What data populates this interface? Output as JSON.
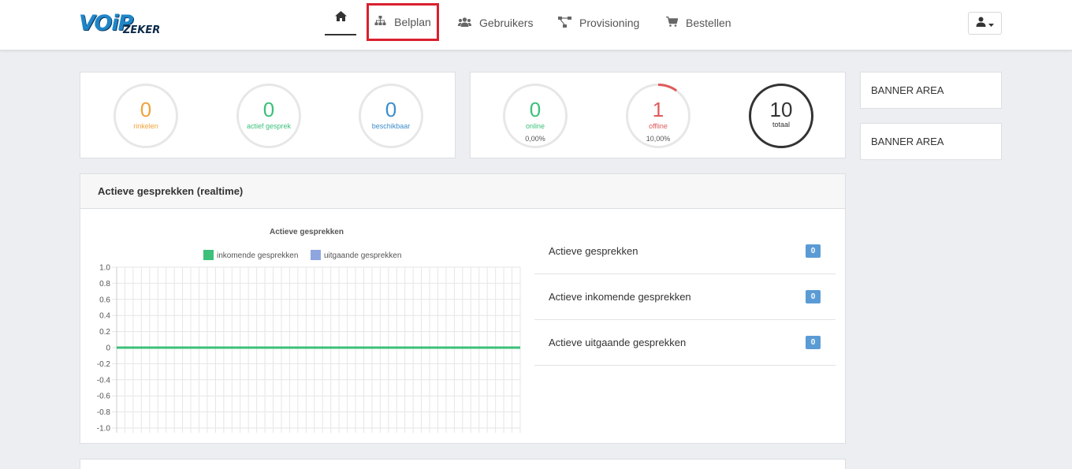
{
  "brand": {
    "logo_main": "VOiP",
    "logo_sub": "ZEKER"
  },
  "nav": {
    "home_icon": "home-icon",
    "items": [
      {
        "label": "Belplan",
        "icon": "sitemap-icon"
      },
      {
        "label": "Gebruikers",
        "icon": "users-icon"
      },
      {
        "label": "Provisioning",
        "icon": "network-icon"
      },
      {
        "label": "Bestellen",
        "icon": "cart-icon"
      }
    ],
    "highlight_color": "#d9202f"
  },
  "stats_calls": [
    {
      "value": "0",
      "label": "rinkelen",
      "color": "#f0a23a"
    },
    {
      "value": "0",
      "label": "actief gesprek",
      "color": "#3cc07a"
    },
    {
      "value": "0",
      "label": "beschikbaar",
      "color": "#3c8dcb"
    }
  ],
  "stats_devices": [
    {
      "value": "0",
      "label": "online",
      "pct": "0,00%",
      "fraction": 0.0,
      "color": "#3cc07a"
    },
    {
      "value": "1",
      "label": "offline",
      "pct": "10,00%",
      "fraction": 0.1,
      "color": "#e05a5a"
    },
    {
      "value": "10",
      "label": "totaal",
      "fraction": 1.0,
      "color": "#333333"
    }
  ],
  "banners": [
    "BANNER AREA",
    "BANNER AREA"
  ],
  "panel": {
    "title": "Actieve gesprekken (realtime)"
  },
  "counters": [
    {
      "label": "Actieve gesprekken",
      "value": "0"
    },
    {
      "label": "Actieve inkomende gesprekken",
      "value": "0"
    },
    {
      "label": "Actieve uitgaande gesprekken",
      "value": "0"
    }
  ],
  "chart_data": {
    "type": "line",
    "title": "Actieve gesprekken",
    "legend": "top",
    "grid": true,
    "ylim": [
      -1.0,
      1.0
    ],
    "yticks": [
      "1.0",
      "0.8",
      "0.6",
      "0.4",
      "0.2",
      "0",
      "-0.2",
      "-0.4",
      "-0.6",
      "-0.8",
      "-1.0"
    ],
    "series": [
      {
        "name": "inkomende gesprekken",
        "color": "#3cc07a",
        "values": [
          0,
          0,
          0,
          0,
          0,
          0,
          0,
          0,
          0,
          0,
          0,
          0,
          0,
          0,
          0,
          0,
          0,
          0,
          0,
          0,
          0,
          0,
          0,
          0,
          0,
          0,
          0,
          0,
          0,
          0,
          0,
          0,
          0,
          0,
          0,
          0,
          0,
          0,
          0,
          0,
          0,
          0,
          0,
          0,
          0,
          0,
          0,
          0,
          0,
          0
        ]
      },
      {
        "name": "uitgaande gesprekken",
        "color": "#8fa5e0",
        "values": [
          0,
          0,
          0,
          0,
          0,
          0,
          0,
          0,
          0,
          0,
          0,
          0,
          0,
          0,
          0,
          0,
          0,
          0,
          0,
          0,
          0,
          0,
          0,
          0,
          0,
          0,
          0,
          0,
          0,
          0,
          0,
          0,
          0,
          0,
          0,
          0,
          0,
          0,
          0,
          0,
          0,
          0,
          0,
          0,
          0,
          0,
          0,
          0,
          0,
          0
        ]
      }
    ]
  }
}
